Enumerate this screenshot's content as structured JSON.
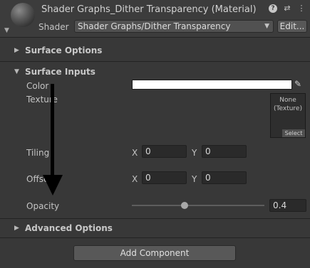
{
  "header": {
    "title": "Shader Graphs_Dither Transparency (Material)",
    "shader_label": "Shader",
    "shader_value": "Shader Graphs/Dither Transparency",
    "edit_label": "Edit...",
    "icons": [
      "help-icon",
      "preset-icon",
      "more-icon"
    ]
  },
  "sections": {
    "surface_options": "Surface Options",
    "surface_inputs": "Surface Inputs",
    "advanced_options": "Advanced Options"
  },
  "props": {
    "color_label": "Color",
    "color_value": "#FFFFFF",
    "texture_label": "Texture",
    "texture_none": "None\n(Texture)",
    "texture_select": "Select",
    "tiling_label": "Tiling",
    "tiling_x_label": "X",
    "tiling_x": "0",
    "tiling_y_label": "Y",
    "tiling_y": "0",
    "offset_label": "Offset",
    "offset_x_label": "X",
    "offset_x": "0",
    "offset_y_label": "Y",
    "offset_y": "0",
    "opacity_label": "Opacity",
    "opacity_value": "0.4",
    "opacity_fraction": 0.4
  },
  "add_component_label": "Add Component"
}
